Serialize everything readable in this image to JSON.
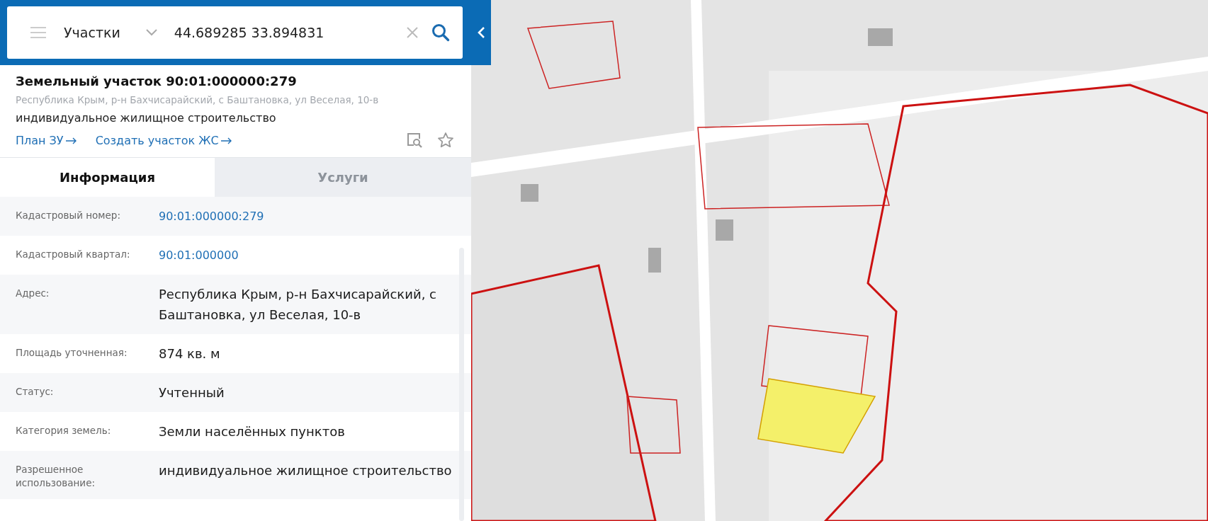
{
  "search": {
    "layer": "Участки",
    "query": "44.689285 33.894831"
  },
  "object": {
    "title": "Земельный участок 90:01:000000:279",
    "address": "Республика Крым, р-н Бахчисарайский, с Баштановка, ул Веселая, 10-в",
    "use": "индивидуальное жилищное строительство",
    "links": [
      {
        "label": "План ЗУ"
      },
      {
        "label": "Создать участок ЖС"
      }
    ]
  },
  "tabs": [
    {
      "label": "Информация",
      "selected": true
    },
    {
      "label": "Услуги",
      "selected": false
    }
  ],
  "fields": [
    {
      "label": "Кадастровый номер:",
      "value": "90:01:000000:279",
      "kind": "link"
    },
    {
      "label": "Кадастровый квартал:",
      "value": "90:01:000000",
      "kind": "link"
    },
    {
      "label": "Адрес:",
      "value": "Республика Крым, р-н Бахчисарайский, с Баштановка, ул Веселая, 10-в",
      "kind": "text"
    },
    {
      "label": "Площадь уточненная:",
      "value": "874 кв. м",
      "kind": "text"
    },
    {
      "label": "Статус:",
      "value": "Учтенный",
      "kind": "text"
    },
    {
      "label": "Категория земель:",
      "value": "Земли населённых пунктов",
      "kind": "text"
    },
    {
      "label": "Разрешенное использование:",
      "value": "индивидуальное жилищное строительство",
      "kind": "text"
    }
  ]
}
